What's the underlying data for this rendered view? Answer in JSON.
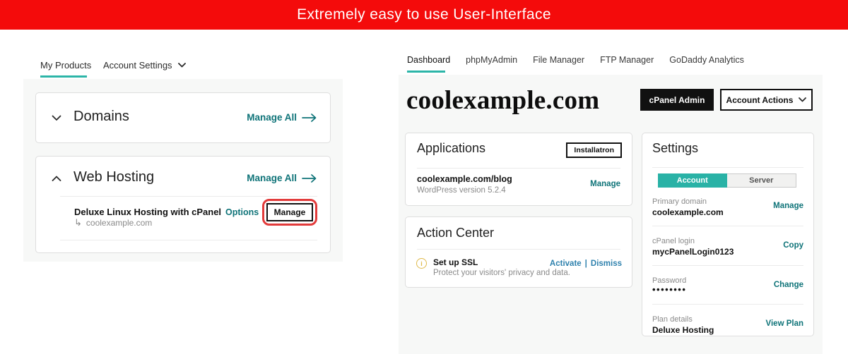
{
  "banner": {
    "text": "Extremely easy to use User-Interface"
  },
  "colors": {
    "banner_red": "#f40b0b",
    "accent_teal": "#2cb5a8",
    "link_teal": "#0e7378",
    "link_blue": "#2e81ad",
    "highlight_red": "#e23b3b",
    "warning_gold": "#dfb94a"
  },
  "left": {
    "tabs": {
      "my_products": "My Products",
      "account_settings": "Account Settings"
    },
    "domains": {
      "title": "Domains",
      "manage_all": "Manage All"
    },
    "web_hosting": {
      "title": "Web Hosting",
      "manage_all": "Manage All",
      "product_name": "Deluxe Linux Hosting with cPanel",
      "options": "Options",
      "manage": "Manage",
      "return_arrow": "↳",
      "domain": "coolexample.com"
    }
  },
  "right": {
    "tabs": [
      "Dashboard",
      "phpMyAdmin",
      "File Manager",
      "FTP Manager",
      "GoDaddy Analytics"
    ],
    "site_title": "coolexample.com",
    "cpanel_admin": "cPanel Admin",
    "account_actions": "Account Actions",
    "applications": {
      "title": "Applications",
      "installatron": "Installatron",
      "app_name": "coolexample.com/blog",
      "app_version": "WordPress version 5.2.4",
      "manage": "Manage"
    },
    "action_center": {
      "title": "Action Center",
      "info_icon": "i",
      "item_title": "Set up SSL",
      "item_desc": "Protect your visitors' privacy and data.",
      "activate": "Activate",
      "separator": "|",
      "dismiss": "Dismiss"
    },
    "settings": {
      "title": "Settings",
      "toggle": {
        "account": "Account",
        "server": "Server"
      },
      "rows": [
        {
          "label": "Primary domain",
          "value": "coolexample.com",
          "action": "Manage"
        },
        {
          "label": "cPanel login",
          "value": "mycPanelLogin0123",
          "action": "Copy"
        },
        {
          "label": "Password",
          "value": "••••••••",
          "action": "Change"
        },
        {
          "label": "Plan details",
          "value": "Deluxe Hosting",
          "action": "View Plan"
        }
      ]
    }
  }
}
